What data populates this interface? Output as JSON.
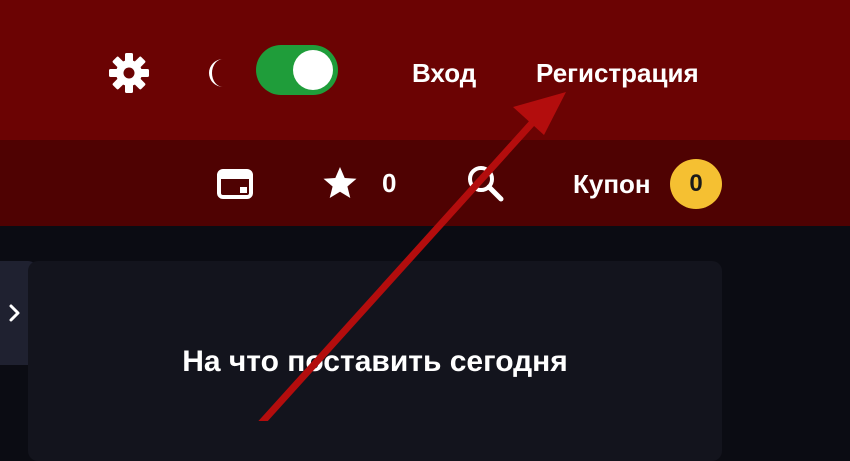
{
  "header": {
    "settings_icon": "gear-icon",
    "theme_icon": "moon-icon",
    "theme_toggle_on": true,
    "login_label": "Вход",
    "register_label": "Регистрация"
  },
  "subheader": {
    "calendar_icon": "calendar-icon",
    "favorites_icon": "star-icon",
    "favorites_count": "0",
    "search_icon": "search-icon",
    "coupon_label": "Купон",
    "coupon_count": "0"
  },
  "sidebar": {
    "toggle_icon": "chevron-right-icon"
  },
  "main": {
    "card_title": "На что поставить сегодня"
  },
  "colors": {
    "header_bg": "#6b0303",
    "subheader_bg": "#4f0202",
    "page_bg": "#0b0c13",
    "toggle_on": "#1f9d3a",
    "coupon_badge": "#f5c032",
    "annotation_arrow": "#b30d0d"
  }
}
